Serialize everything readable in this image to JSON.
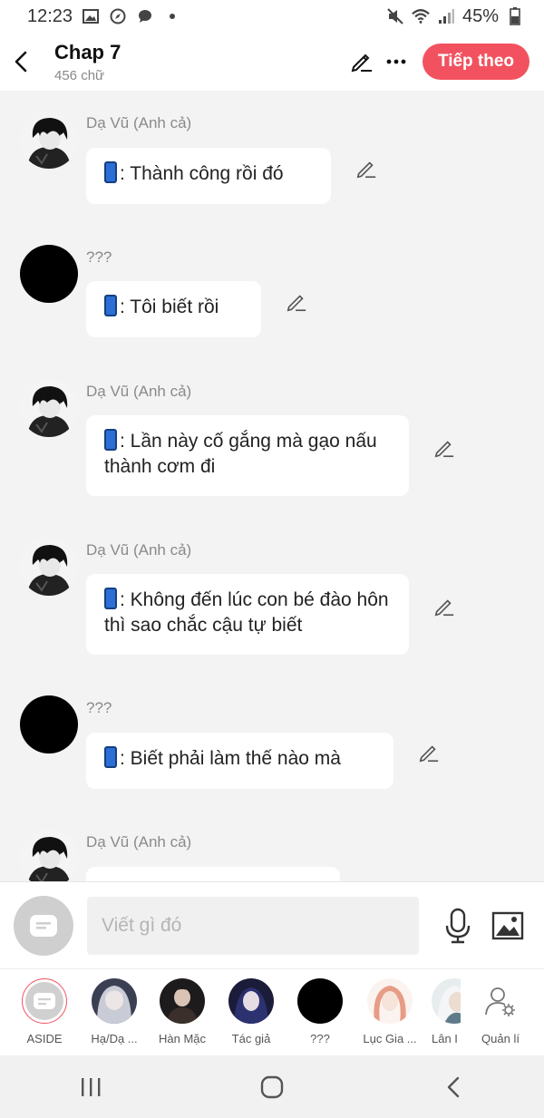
{
  "status_bar": {
    "time": "12:23",
    "battery": "45%"
  },
  "header": {
    "title": "Chap 7",
    "word_count": "456 chữ",
    "next_label": "Tiếp theo"
  },
  "messages": [
    {
      "sender": "Dạ Vũ (Anh cả)",
      "avatar": "dark-hair-character",
      "text": ": Thành công rồi đó"
    },
    {
      "sender": "???",
      "avatar": "black-circle",
      "text": ": Tôi biết rồi"
    },
    {
      "sender": "Dạ Vũ (Anh cả)",
      "avatar": "dark-hair-character",
      "text": ": Lần này cố gắng mà gạo nấu thành cơm đi"
    },
    {
      "sender": "Dạ Vũ (Anh cả)",
      "avatar": "dark-hair-character",
      "text": ": Không đến lúc con bé đào hôn thì sao chắc cậu tự biết"
    },
    {
      "sender": "???",
      "avatar": "black-circle",
      "text": ": Biết phải làm thế nào mà"
    },
    {
      "sender": "Dạ Vũ (Anh cả)",
      "avatar": "dark-hair-character",
      "text": ""
    }
  ],
  "composer": {
    "placeholder": "Viết gì đó"
  },
  "characters": [
    {
      "name": "ASIDE",
      "avatar": "aside-icon"
    },
    {
      "name": "Hạ/Dạ ...",
      "avatar": "silver-hair-character"
    },
    {
      "name": "Hàn Mặc",
      "avatar": "dark-suit-character"
    },
    {
      "name": "Tác giả",
      "avatar": "blue-hair-character"
    },
    {
      "name": "???",
      "avatar": "black-circle"
    },
    {
      "name": "Lục Gia ...",
      "avatar": "pink-hair-character"
    },
    {
      "name": "Lân I",
      "avatar": "white-hair-character"
    },
    {
      "name": "Quản lí",
      "avatar": "user-gear-icon"
    }
  ],
  "colors": {
    "accent": "#f2525f",
    "background": "#f3f3f3",
    "bubble": "#ffffff"
  }
}
